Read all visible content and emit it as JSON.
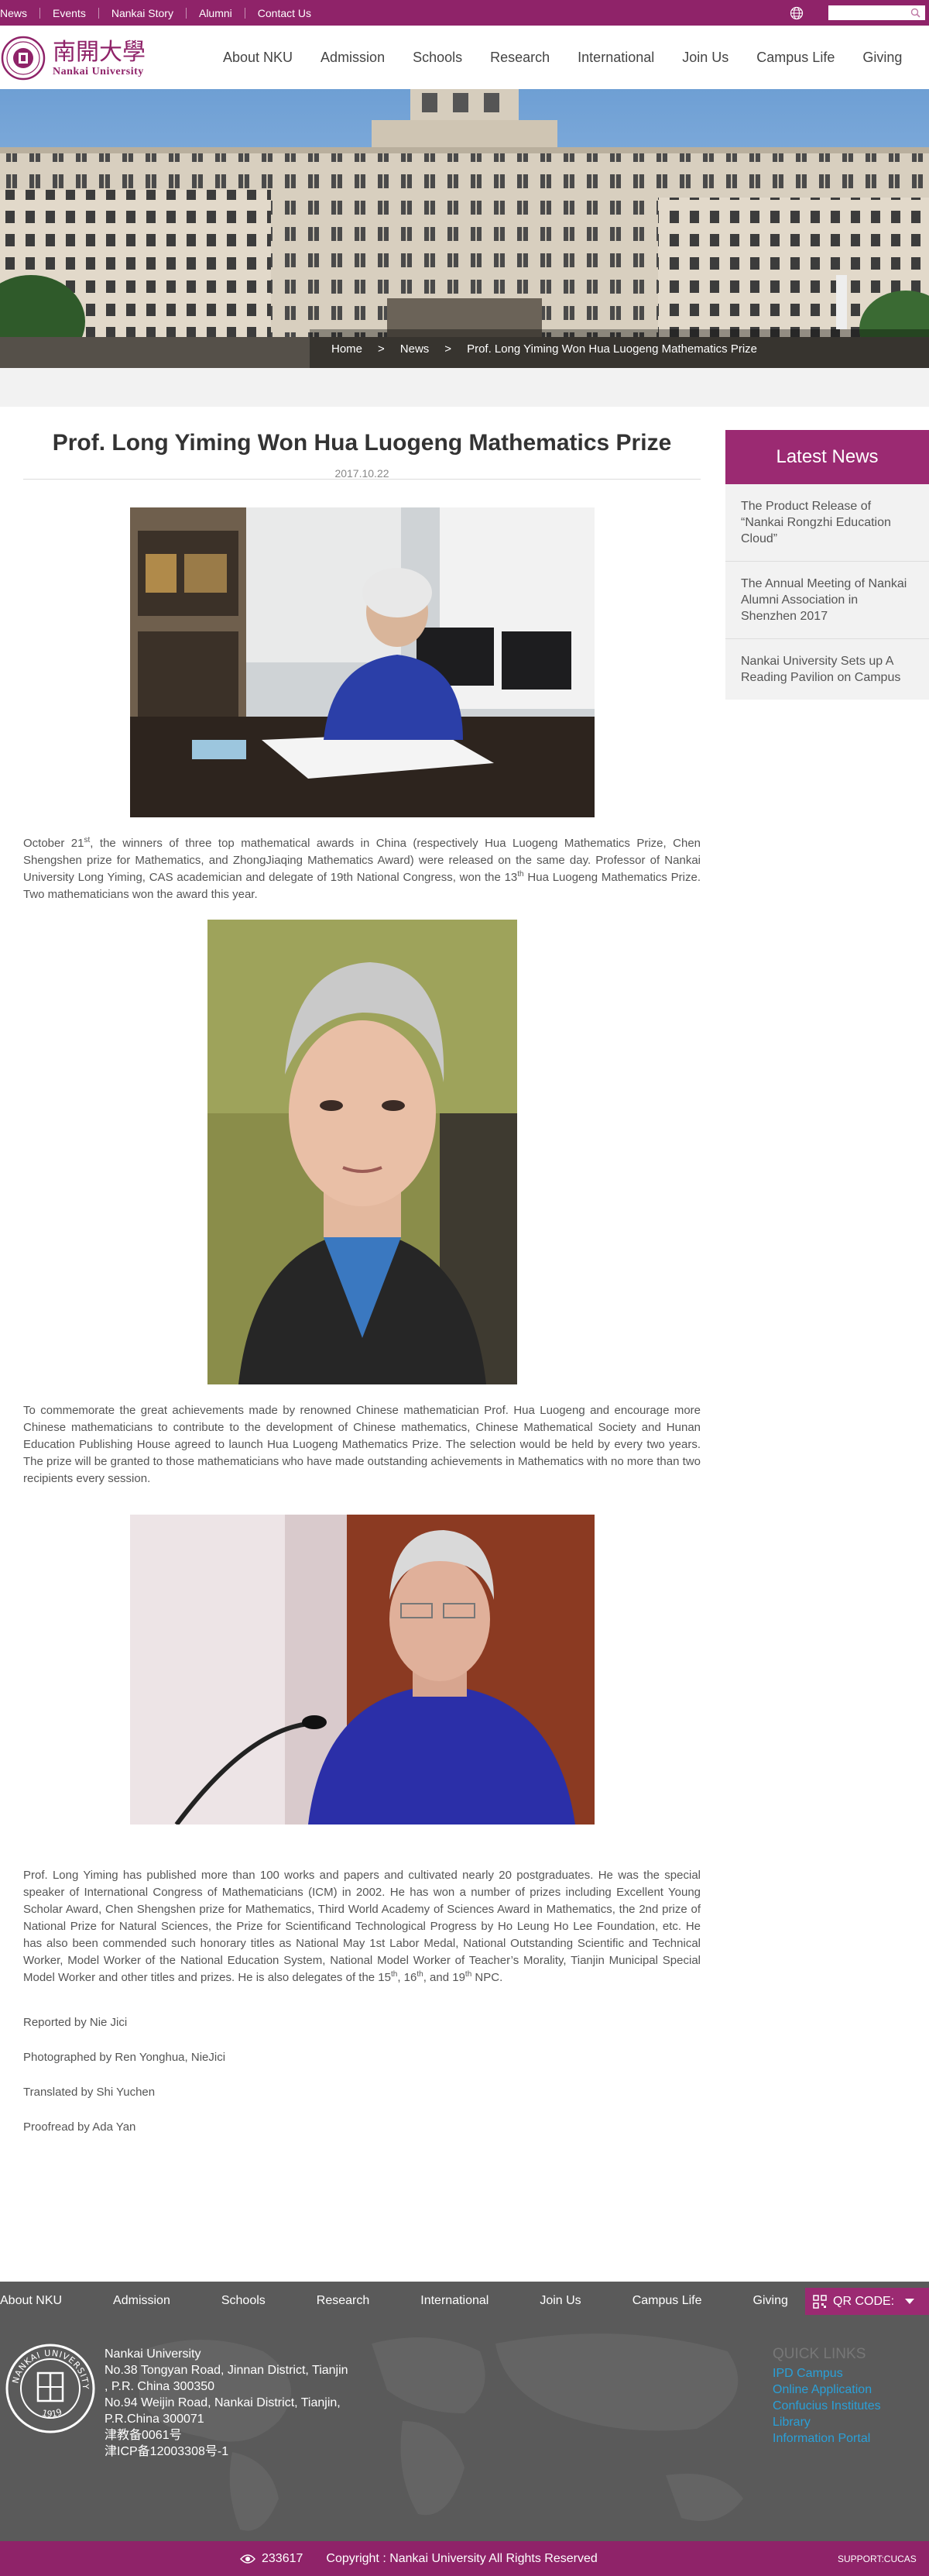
{
  "topbar": {
    "links": [
      "News",
      "Events",
      "Nankai Story",
      "Alumni",
      "Contact Us"
    ],
    "search_placeholder": ""
  },
  "header": {
    "logo_chinese": "南開大學",
    "logo_english": "Nankai University",
    "nav": [
      "About NKU",
      "Admission",
      "Schools",
      "Research",
      "International",
      "Join Us",
      "Campus Life",
      "Giving"
    ]
  },
  "breadcrumb": [
    "Home",
    "News",
    "Prof. Long Yiming Won Hua Luogeng Mathematics Prize"
  ],
  "breadcrumb_separator": ">",
  "article": {
    "title": "Prof. Long Yiming Won Hua Luogeng Mathematics Prize",
    "date": "2017.10.22",
    "p1": {
      "a": "October 21",
      "a_sup": "st",
      "b": ", the winners of three top mathematical awards in China (respectively Hua Luogeng Mathematics Prize, Chen Shengshen prize for Mathematics, and ZhongJiaqing Mathematics Award) were released on the same day. Professor of Nankai University Long Yiming, CAS academician and delegate of 19th National Congress, won the 13",
      "b_sup": "th",
      "c": " Hua Luogeng Mathematics Prize. Two mathematicians won the award this year."
    },
    "p2": "To commemorate the great achievements made by renowned Chinese mathematician Prof. Hua Luogeng and encourage more Chinese mathematicians to contribute to the development of Chinese mathematics, Chinese Mathematical Society and Hunan Education Publishing House agreed to launch Hua Luogeng Mathematics Prize. The selection would be held by every two years. The prize will be granted to those mathematicians who have made outstanding achievements in Mathematics with no more than two recipients every session.",
    "p3": {
      "a": "Prof. Long Yiming has published more than 100 works and papers and cultivated nearly 20 postgraduates. He was the special speaker of International Congress of Mathematicians (ICM) in 2002. He has won a number of prizes including Excellent Young Scholar Award, Chen Shengshen prize for Mathematics, Third World Academy of Sciences Award in Mathematics, the 2nd prize of National Prize for Natural Sciences, the Prize for Scientificand Technological Progress by Ho Leung Ho Lee Foundation, etc. He has also been commended such honorary titles as National May 1st Labor Medal, National Outstanding Scientific and Technical Worker, Model Worker of the National Education System, National Model Worker of Teacher’s Morality, Tianjin Municipal Special Model Worker and other titles and prizes. He is also delegates of the 15",
      "sup1": "th",
      "b": ", 16",
      "sup2": "th",
      "c": ", and 19",
      "sup3": "th",
      "d": " NPC."
    },
    "credits": [
      "Reported by Nie Jici",
      "Photographed by Ren Yonghua, NieJici",
      "Translated by Shi Yuchen",
      "Proofread by Ada Yan"
    ]
  },
  "sidebar": {
    "heading": "Latest News",
    "items": [
      "The Product Release of “Nankai Rongzhi Education Cloud”",
      "The Annual Meeting of Nankai Alumni Association in Shenzhen 2017",
      "Nankai University Sets up A Reading Pavilion on Campus"
    ]
  },
  "footer": {
    "nav": [
      "About NKU",
      "Admission",
      "Schools",
      "Research",
      "International",
      "Join Us",
      "Campus Life",
      "Giving"
    ],
    "qr_label": "QR CODE:",
    "address": [
      "Nankai University",
      "No.38 Tongyan Road, Jinnan District, Tianjin",
      ", P.R. China 300350",
      "No.94 Weijin Road,  Nankai District, Tianjin,",
      "P.R.China  300071",
      "津教备0061号",
      "津ICP备12003308号-1"
    ],
    "quick_heading": "QUICK LINKS",
    "quick_links": [
      "IPD Campus",
      "Online Application",
      "Confucius Institutes",
      "Library",
      "Information Portal"
    ],
    "emblem_year": "1919",
    "emblem_text": "NANKAI UNIVERSITY",
    "visits": "233617",
    "copyright": "Copyright : Nankai University All Rights Reserved",
    "support": "SUPPORT:CUCAS"
  },
  "colors": {
    "brand": "#8f2369",
    "sidebar_head": "#9b2a72",
    "link": "#2aa0d8"
  }
}
